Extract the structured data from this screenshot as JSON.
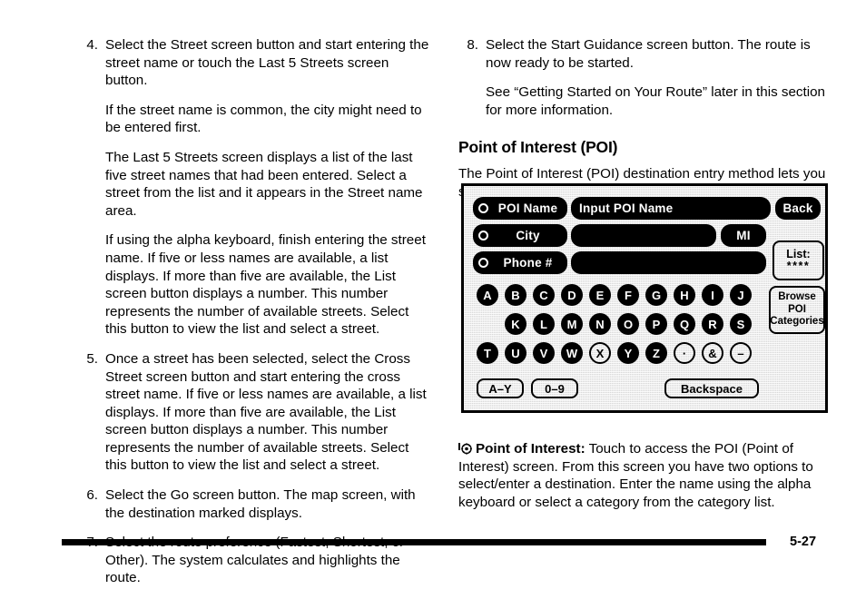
{
  "page": {
    "folio": "5-27"
  },
  "left_column": {
    "steps": [
      {
        "num": "4.",
        "paragraphs": [
          "Select the Street screen button and start entering the street name or touch the Last 5 Streets screen button.",
          "If the street name is common, the city might need to be entered first.",
          "The Last 5 Streets screen displays a list of the last five street names that had been entered. Select a street from the list and it appears in the Street name area.",
          "If using the alpha keyboard, finish entering the street name. If five or less names are available, a list displays. If more than five are available, the List screen button displays a number. This number represents the number of available streets. Select this button to view the list and select a street."
        ]
      },
      {
        "num": "5.",
        "paragraphs": [
          "Once a street has been selected, select the Cross Street screen button and start entering the cross street name. If five or less names are available, a list displays. If more than five are available, the List screen button displays a number. This number represents the number of available streets. Select this button to view the list and select a street."
        ]
      },
      {
        "num": "6.",
        "paragraphs": [
          "Select the Go screen button. The map screen, with the destination marked displays."
        ]
      },
      {
        "num": "7.",
        "paragraphs": [
          "Select the route preference (Fastest, Shortest, or Other). The system calculates and highlights the route."
        ]
      }
    ]
  },
  "right_column": {
    "steps": [
      {
        "num": "8.",
        "paragraphs": [
          "Select the Start Guidance screen button. The route is now ready to be started.",
          "See “Getting Started on Your Route” later in this section for more information."
        ]
      }
    ],
    "heading": "Point of Interest (POI)",
    "intro": "The Point of Interest (POI) destination entry method lets you select a destination from the POI list."
  },
  "nav_screen": {
    "rows": [
      {
        "label": "POI Name",
        "field_value": "Input POI Name"
      },
      {
        "label": "City",
        "field_value": ""
      },
      {
        "label": "Phone #",
        "field_value": ""
      }
    ],
    "state_button": "MI",
    "back_button": "Back",
    "list_button": {
      "line1": "List:",
      "line2": "****"
    },
    "browse_button": {
      "line1": "Browse",
      "line2": "POI",
      "line3": "Categories"
    },
    "keyboard": {
      "row1": [
        "A",
        "B",
        "C",
        "D",
        "E",
        "F",
        "G",
        "H",
        "I",
        "J"
      ],
      "row2": [
        "K",
        "L",
        "M",
        "N",
        "O",
        "P",
        "Q",
        "R",
        "S"
      ],
      "row3": [
        "T",
        "U",
        "V",
        "W",
        "X",
        "Y",
        "Z",
        "·",
        "&",
        "–"
      ],
      "row3_dim": [
        false,
        false,
        false,
        false,
        true,
        false,
        false,
        true,
        true,
        true
      ],
      "bottom": [
        {
          "label": "A–Y"
        },
        {
          "label": "0–9"
        },
        {
          "label": "Backspace"
        }
      ]
    }
  },
  "caption": {
    "icon": "poi-marker-icon",
    "term": "Point of Interest:",
    "text": " Touch to access the POI (Point of Interest) screen. From this screen you have two options to select/enter a destination. Enter the name using the alpha keyboard or select a category from the category list."
  }
}
